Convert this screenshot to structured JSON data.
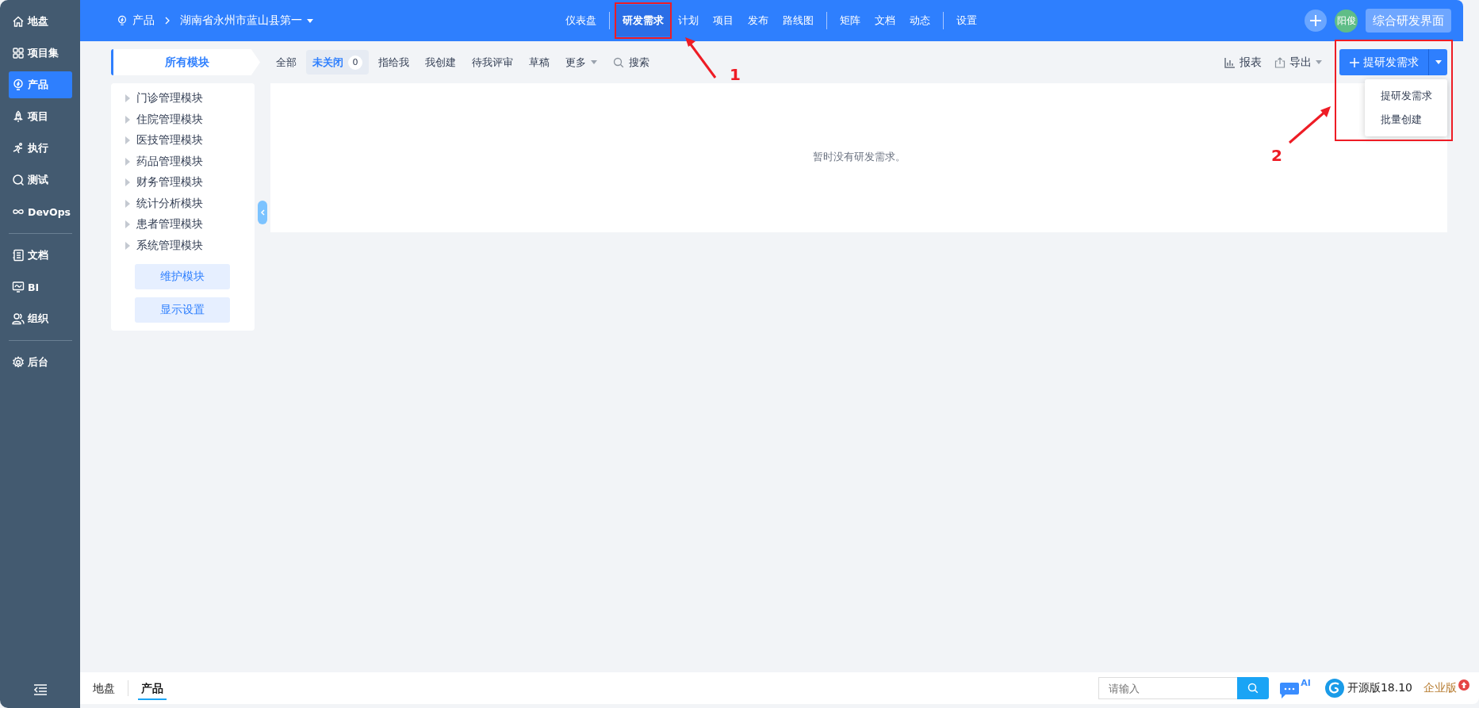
{
  "sidebar": {
    "groups": [
      [
        {
          "label": "地盘",
          "selected": false
        },
        {
          "label": "项目集",
          "selected": false
        },
        {
          "label": "产品",
          "selected": true
        },
        {
          "label": "项目",
          "selected": false
        },
        {
          "label": "执行",
          "selected": false
        },
        {
          "label": "测试",
          "selected": false
        },
        {
          "label": "DevOps",
          "selected": false
        }
      ],
      [
        {
          "label": "文档",
          "selected": false
        },
        {
          "label": "BI",
          "selected": false
        },
        {
          "label": "组织",
          "selected": false
        }
      ],
      [
        {
          "label": "后台",
          "selected": false
        }
      ]
    ]
  },
  "header": {
    "breadcrumb": {
      "section": "产品",
      "product": "湖南省永州市蓝山县第一"
    },
    "nav_groups": [
      [
        {
          "label": "仪表盘",
          "selected": false
        }
      ],
      [
        {
          "label": "研发需求",
          "selected": true
        },
        {
          "label": "计划",
          "selected": false
        },
        {
          "label": "项目",
          "selected": false
        },
        {
          "label": "发布",
          "selected": false
        },
        {
          "label": "路线图",
          "selected": false
        }
      ],
      [
        {
          "label": "矩阵",
          "selected": false
        },
        {
          "label": "文档",
          "selected": false
        },
        {
          "label": "动态",
          "selected": false
        }
      ],
      [
        {
          "label": "设置",
          "selected": false
        }
      ]
    ],
    "avatar": "阳俊",
    "view_button": "综合研发界面"
  },
  "toolbar": {
    "module_tab": "所有模块",
    "filters": [
      {
        "label": "全部",
        "kind": "plain",
        "selected": false
      },
      {
        "label": "未关闭",
        "kind": "plain",
        "count": "0",
        "selected": true
      },
      {
        "label": "指给我",
        "kind": "plain",
        "selected": false
      },
      {
        "label": "我创建",
        "kind": "plain",
        "selected": false
      },
      {
        "label": "待我评审",
        "kind": "plain",
        "selected": false
      },
      {
        "label": "草稿",
        "kind": "plain",
        "selected": false
      },
      {
        "label": "更多",
        "kind": "dropdown",
        "selected": false
      },
      {
        "label": "搜索",
        "kind": "search",
        "selected": false
      }
    ],
    "report": "报表",
    "export": "导出",
    "create_button": "提研发需求",
    "create_menu": [
      "提研发需求",
      "批量创建"
    ]
  },
  "modules": {
    "items": [
      "门诊管理模块",
      "住院管理模块",
      "医技管理模块",
      "药品管理模块",
      "财务管理模块",
      "统计分析模块",
      "患者管理模块",
      "系统管理模块"
    ],
    "buttons": [
      "维护模块",
      "显示设置"
    ]
  },
  "empty_message": "暂时没有研发需求。",
  "bottom_bar": {
    "tabs": [
      {
        "label": "地盘",
        "selected": false
      },
      {
        "label": "产品",
        "selected": true
      }
    ],
    "search": {
      "placeholder": "请输入"
    },
    "ai_badge": "AI",
    "version": "开源版18.10",
    "edition": "企业版"
  },
  "annotations": [
    {
      "label": "1"
    },
    {
      "label": "2"
    }
  ]
}
